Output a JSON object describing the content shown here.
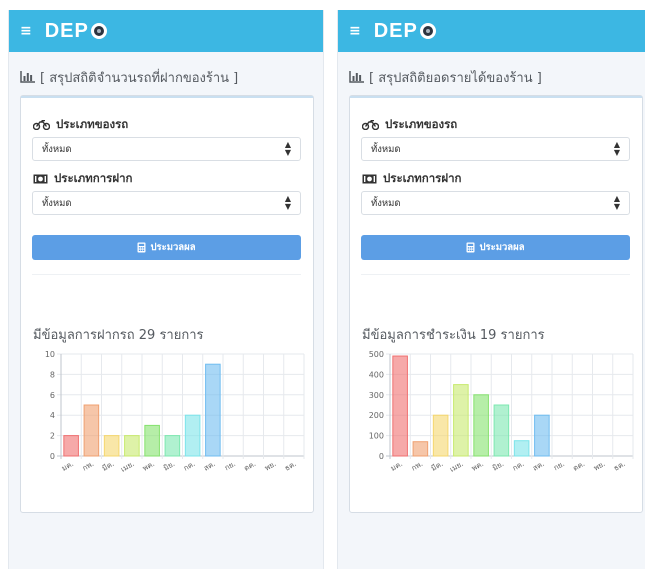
{
  "app": {
    "logo_text": "DEP",
    "menu_icon": "hamburger-icon",
    "logo_icon": "tire-icon",
    "brand_color": "#3cb7e3",
    "button_color": "#5c9ee5"
  },
  "form_labels": {
    "vehicle_type": "ประเภทของรถ",
    "deposit_type": "ประเภทการฝาก",
    "select_all": "ทั้งหมด",
    "submit": "ประมวลผล"
  },
  "left": {
    "heading": "[ สรุปสถิติจำนวนรถที่ฝากของร้าน ]",
    "result_prefix": "มีข้อมูลการฝากรถ",
    "result_count": "29",
    "result_suffix": "รายการ"
  },
  "right": {
    "heading": "[ สรุปสถิติยอดรายได้ของร้าน ]",
    "result_prefix": "มีข้อมูลการชำระเงิน",
    "result_count": "19",
    "result_suffix": "รายการ"
  },
  "chart_data": [
    {
      "type": "bar",
      "categories": [
        "มค.",
        "กพ.",
        "มีค.",
        "เมย.",
        "พค.",
        "มิย.",
        "กค.",
        "สค.",
        "กย.",
        "ตค.",
        "พย.",
        "ธค."
      ],
      "values": [
        2,
        5,
        2,
        2,
        3,
        2,
        4,
        9,
        0,
        0,
        0,
        0
      ],
      "ylim": [
        0,
        10
      ],
      "yticks": [
        0,
        2,
        4,
        6,
        8,
        10
      ],
      "grid": true,
      "colors": [
        "#f07070",
        "#f0a070",
        "#f5d76e",
        "#c8ea6e",
        "#86e26e",
        "#7ce8b0",
        "#7de4ea",
        "#70bdf0",
        "#8fa6f0",
        "#b98ef0",
        "#ea86d8",
        "#f07ea0"
      ]
    },
    {
      "type": "bar",
      "categories": [
        "มค.",
        "กพ.",
        "มีค.",
        "เมย.",
        "พค.",
        "มิย.",
        "กค.",
        "สค.",
        "กย.",
        "ตค.",
        "พย.",
        "ธค."
      ],
      "values": [
        490,
        70,
        200,
        350,
        300,
        250,
        75,
        200,
        0,
        0,
        0,
        0
      ],
      "ylim": [
        0,
        500
      ],
      "yticks": [
        0,
        100,
        200,
        300,
        400,
        500
      ],
      "grid": true,
      "colors": [
        "#f07070",
        "#f0a070",
        "#f5d76e",
        "#c8ea6e",
        "#86e26e",
        "#7ce8b0",
        "#7de4ea",
        "#70bdf0",
        "#8fa6f0",
        "#b98ef0",
        "#ea86d8",
        "#f07ea0"
      ]
    }
  ]
}
